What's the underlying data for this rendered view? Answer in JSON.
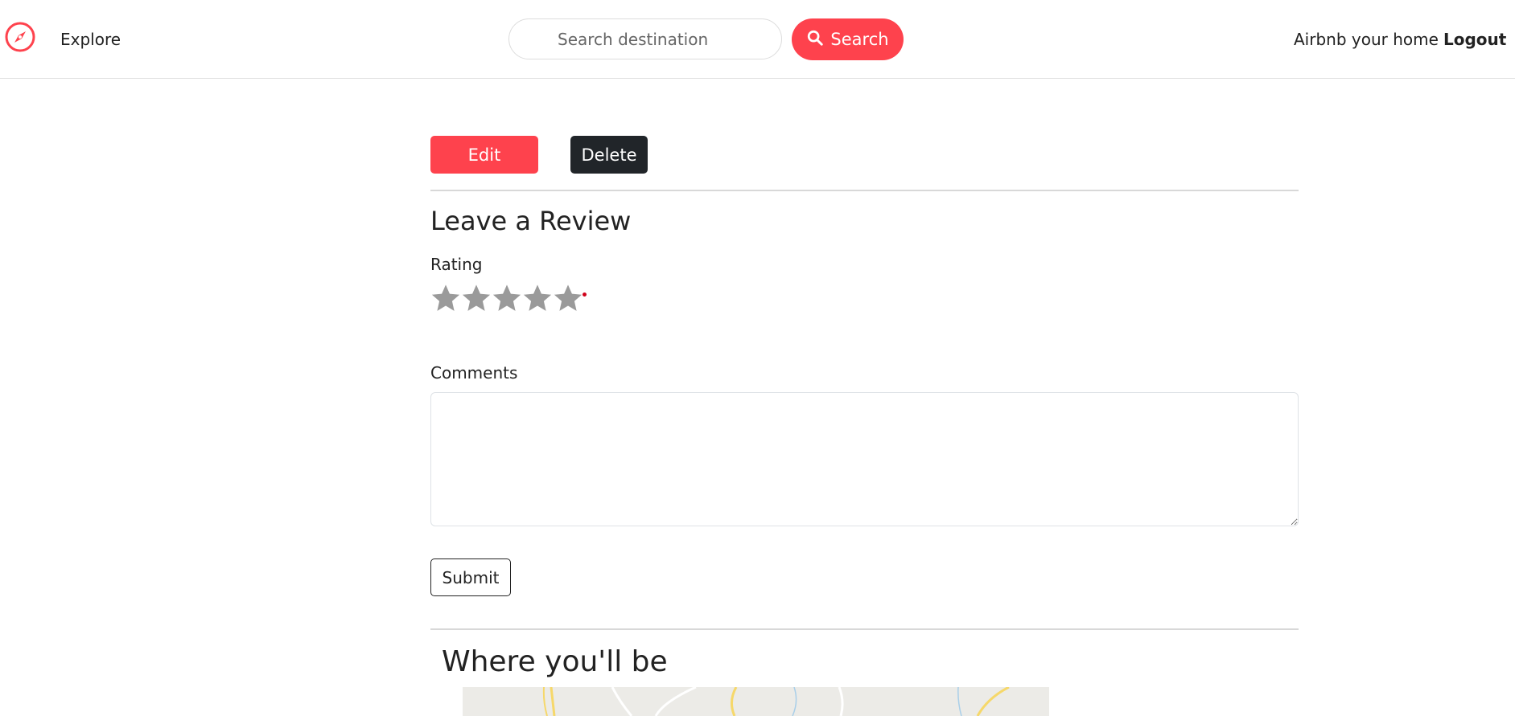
{
  "navbar": {
    "logo_icon": "compass-icon",
    "explore_label": "Explore",
    "search_placeholder": "Search destination",
    "search_button_label": "Search",
    "host_label": "Airbnb your home",
    "logout_label": "Logout",
    "accent_color": "#fe424d"
  },
  "listing_actions": {
    "edit_label": "Edit",
    "delete_label": "Delete"
  },
  "review": {
    "heading": "Leave a Review",
    "rating_label": "Rating",
    "rating_max": 5,
    "comments_label": "Comments",
    "comments_value": "",
    "submit_label": "Submit"
  },
  "map_section": {
    "heading": "Where you'll be"
  }
}
